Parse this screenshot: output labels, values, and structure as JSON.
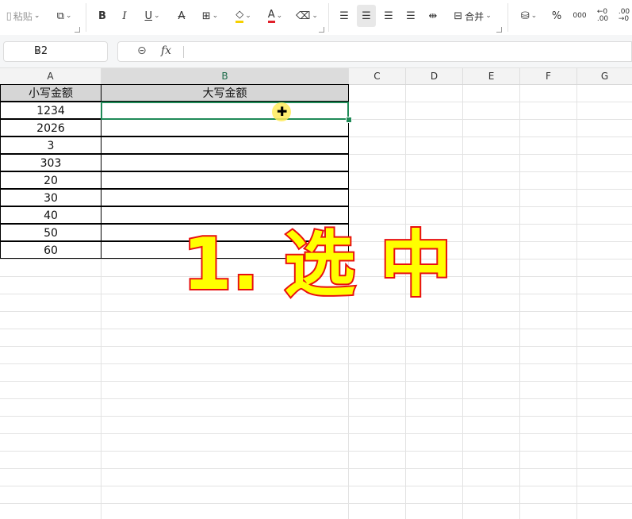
{
  "toolbar": {
    "paste_label": "粘贴",
    "merge_label": "合并",
    "bold_label": "B",
    "italic_label": "I",
    "underline_label": "U",
    "percent_label": "%",
    "thousand_label": "000",
    "font_color": "#e0202a"
  },
  "formula_bar": {
    "name_box": "B2",
    "fx_label": "fx",
    "formula": ""
  },
  "columns": [
    "A",
    "B",
    "C",
    "D",
    "E",
    "F",
    "G"
  ],
  "selected_column": "B",
  "table": {
    "header_a": "小写金额",
    "header_b": "大写金额",
    "values": [
      "1234",
      "2026",
      "3",
      "303",
      "20",
      "30",
      "40",
      "50",
      "60"
    ]
  },
  "overlay": {
    "text": "1. 选 中",
    "fill_color": "#ffff00",
    "stroke_color": "#e81010"
  },
  "colors": {
    "selection": "#1f8a57"
  }
}
